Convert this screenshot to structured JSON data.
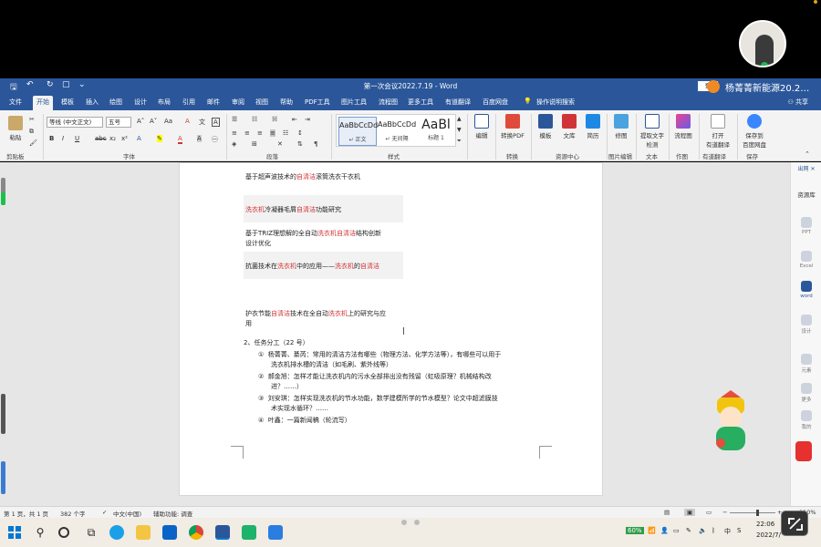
{
  "title_bar": {
    "doc_title": "第一次会议2022.7.19 - Word",
    "login": "登",
    "presenter": "杨菁菁新能源20.2…"
  },
  "tabs": [
    "文件",
    "开始",
    "模板",
    "插入",
    "绘图",
    "设计",
    "布局",
    "引用",
    "邮件",
    "审阅",
    "视图",
    "帮助",
    "PDF工具",
    "图片工具",
    "流程图",
    "更多工具",
    "有道翻译",
    "百度网盘"
  ],
  "active_tab": "开始",
  "tell_me": "操作说明搜索",
  "share": "共享",
  "ribbon": {
    "paste": "粘贴",
    "font_name": "等线 (中文正文)",
    "font_size": "五号",
    "styles": [
      {
        "preview": "AaBbCcDd",
        "name": "↵ 正文"
      },
      {
        "preview": "AaBbCcDd",
        "name": "↵ 无间隔"
      },
      {
        "preview": "AaBl",
        "name": "标题 1"
      }
    ],
    "buttons": {
      "edit": "编辑",
      "to_pdf": "转换PDF",
      "template": "模板",
      "library": "文库",
      "resume": "简历",
      "retouch": "修图",
      "ocr_line1": "提取文字",
      "ocr_line2": "检测",
      "flowchart": "流程图",
      "open_line1": "打开",
      "open_line2": "有道翻译",
      "save_line1": "保存到",
      "save_line2": "百度网盘"
    },
    "group_labels": [
      "剪贴板",
      "字体",
      "段落",
      "样式",
      "转换",
      "资源中心",
      "图片编辑",
      "文本",
      "作图",
      "有道翻译",
      "保存"
    ]
  },
  "document": {
    "line1": [
      "基于超声波技术的",
      "自清洁",
      "滚筒洗衣干衣机"
    ],
    "line2": [
      "洗衣机",
      "冷凝器毛屑",
      "自清洁",
      "功能研究"
    ],
    "line3a": [
      "基于TRIZ理想解的全自动",
      "洗衣机自清洁",
      "结构创新"
    ],
    "line3b": "设计优化",
    "line4": [
      "抗菌技术在",
      "洗衣机",
      "中的应用——",
      "洗衣机",
      "的",
      "自清洁"
    ],
    "line5a": [
      "护衣节能",
      "自清洁",
      "技术在全自动",
      "洗衣机",
      "上的研究与应"
    ],
    "line5b": "用",
    "section": "2、任务分工（22 号）",
    "tasks": [
      {
        "num": "①",
        "text": "杨菁菁、綦芮：常用的清洁方法有哪些（物理方法、化学方法等），有哪些可以用于",
        "cont": "洗衣机排水槽的清洁（如毛刷、紫外线等）"
      },
      {
        "num": "②",
        "text": "郝金旭：怎样才能让洗衣机内的污水全部排出没有残留（虹吸原理？机械结构改",
        "cont": "进？……）"
      },
      {
        "num": "③",
        "text": "刘安琪：怎样实现洗衣机的节水功能，数学建模所学的节水模型？论文中超滤膜技",
        "cont": "术实现水循环？……"
      },
      {
        "num": "④",
        "text": "叶鑫：一篇新闻稿（轮流写）",
        "cont": ""
      }
    ]
  },
  "side_pane": {
    "header": "出网",
    "library": "资源库",
    "items": [
      "PPT",
      "Excel",
      "word",
      "设计",
      "元素",
      "更多",
      "我的"
    ]
  },
  "status_bar": {
    "page": "第 1 页，共 1 页",
    "words": "382 个字",
    "lang": "中文(中国)",
    "accessibility": "辅助功能: 调查",
    "zoom": "110%"
  },
  "taskbar": {
    "battery": "60%",
    "ime": "中",
    "time": "22:06",
    "date": "2022/7/"
  },
  "colors": {
    "word_blue": "#2b579a",
    "highlight_red": "#d13438"
  }
}
